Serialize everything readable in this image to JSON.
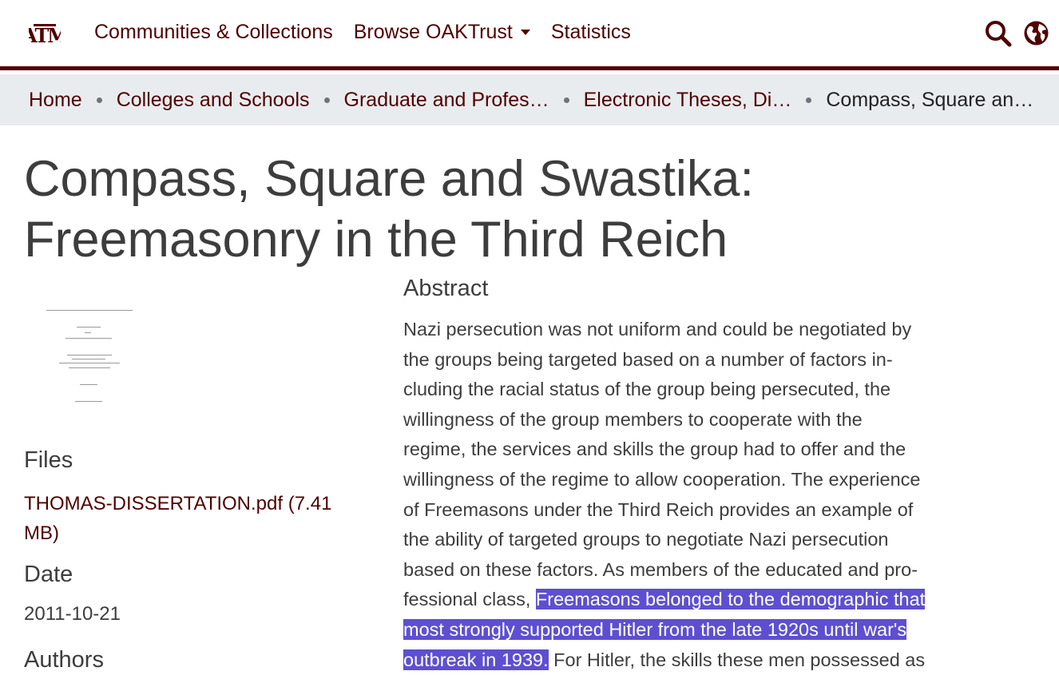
{
  "header": {
    "logo_text": "ATM",
    "nav": [
      {
        "label": "Communities & Collections"
      },
      {
        "label": "Browse OAKTrust"
      },
      {
        "label": "Statistics"
      }
    ]
  },
  "breadcrumb": [
    {
      "label": "Home"
    },
    {
      "label": "Colleges and Schools"
    },
    {
      "label": "Graduate and Profes…"
    },
    {
      "label": "Electronic Theses, Di…"
    },
    {
      "label": "Compass, Square an…"
    }
  ],
  "page": {
    "title": "Compass, Square and Swastika: Freemasonry in the Third Reich"
  },
  "files": {
    "heading": "Files",
    "link_label": "THOMAS-DISSERTATION.pdf (7.41 MB)"
  },
  "date": {
    "heading": "Date",
    "value": "2011-10-21"
  },
  "authors": {
    "heading": "Authors"
  },
  "abstract": {
    "heading": "Abstract",
    "text_before": "Nazi persecution was not uniform and could be negotiated by\nthe groups being targeted based on a number of factors in-\ncluding the racial status of the group being persecuted, the\nwillingness of the group members to cooperate with the\nregime, the services and skills the group had to offer and the\nwillingness of the regime to allow cooperation. The experience\nof Freemasons under the Third Reich provides an example of\nthe ability of targeted groups to negotiate Nazi persecution\nbased on these factors. As members of the educated and pro-\nfessional class, ",
    "text_highlighted": "Freemasons belonged to the demographic that\nmost strongly supported Hitler from the late 1920s until war's\noutbreak in 1939.",
    "text_after": " For Hitler, the skills these men possessed as"
  },
  "colors": {
    "brand_maroon": "#500000",
    "highlight": "#5d4fd0",
    "breadcrumb_bg": "#e9ecef"
  }
}
